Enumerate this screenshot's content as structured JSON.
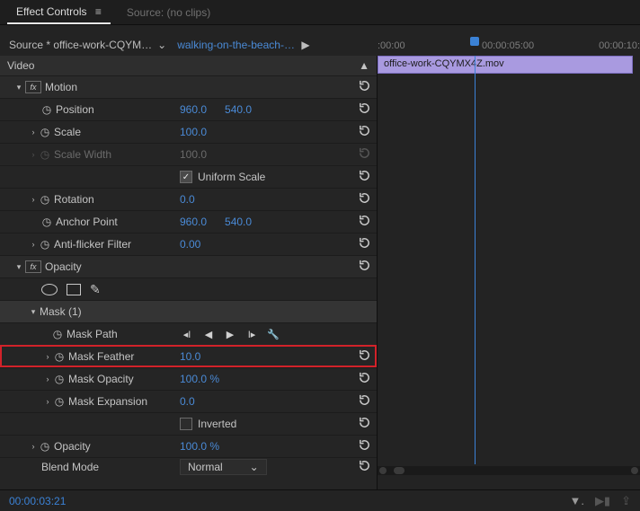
{
  "tabs": {
    "effect_controls": "Effect Controls",
    "source": "Source: (no clips)"
  },
  "source": {
    "master": "Source * office-work-CQYM…",
    "instance": "walking-on-the-beach-…"
  },
  "ruler": {
    "t0": ":00:00",
    "t1": "00:00:05:00",
    "t2": "00:00:10:"
  },
  "clip_name": "office-work-CQYMX4Z.mov",
  "video_label": "Video",
  "motion": {
    "label": "Motion",
    "position": {
      "label": "Position",
      "x": "960.0",
      "y": "540.0"
    },
    "scale": {
      "label": "Scale",
      "v": "100.0"
    },
    "scale_width": {
      "label": "Scale Width",
      "v": "100.0"
    },
    "uniform": {
      "label": "Uniform Scale"
    },
    "rotation": {
      "label": "Rotation",
      "v": "0.0"
    },
    "anchor": {
      "label": "Anchor Point",
      "x": "960.0",
      "y": "540.0"
    },
    "antiflicker": {
      "label": "Anti-flicker Filter",
      "v": "0.00"
    }
  },
  "opacity": {
    "label": "Opacity"
  },
  "mask": {
    "label": "Mask (1)",
    "path": {
      "label": "Mask Path"
    },
    "feather": {
      "label": "Mask Feather",
      "v": "10.0"
    },
    "mask_opacity": {
      "label": "Mask Opacity",
      "v": "100.0 %"
    },
    "expansion": {
      "label": "Mask Expansion",
      "v": "0.0"
    },
    "inverted": {
      "label": "Inverted"
    }
  },
  "opacity_prop": {
    "label": "Opacity",
    "v": "100.0 %"
  },
  "blend": {
    "label": "Blend Mode",
    "v": "Normal"
  },
  "timecode": "00:00:03:21",
  "playhead_pct": 37
}
